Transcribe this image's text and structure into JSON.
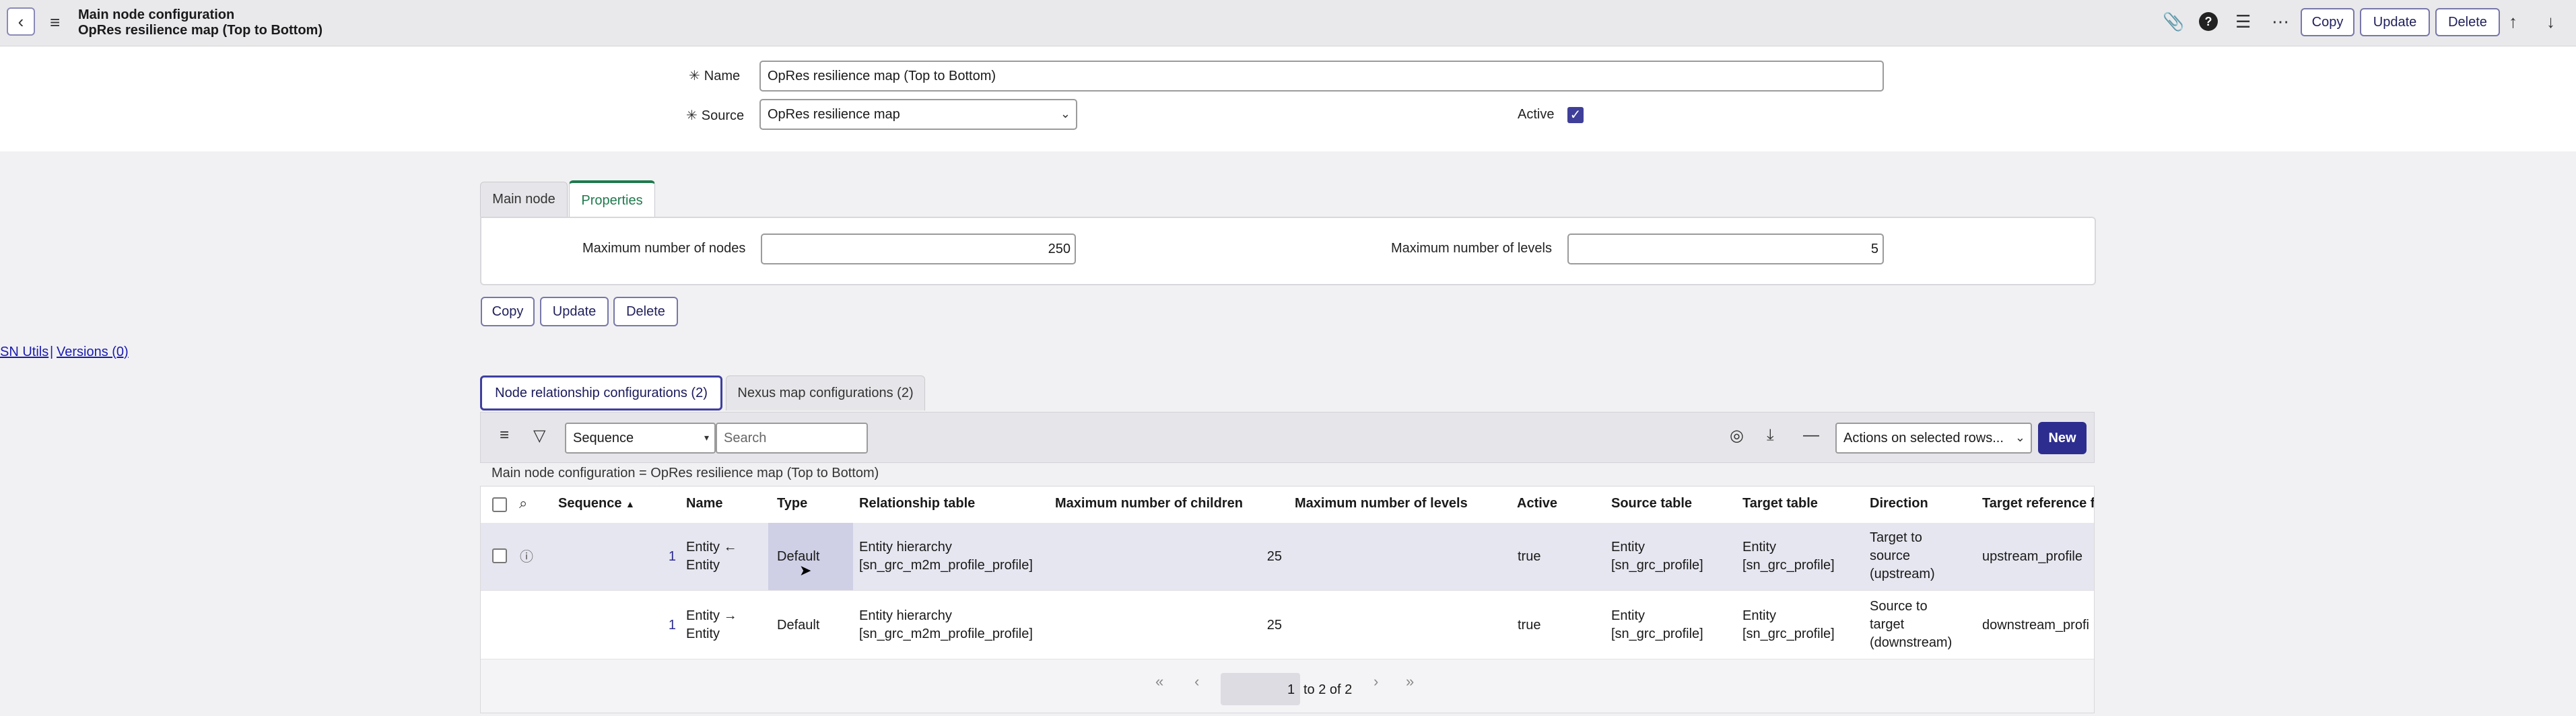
{
  "header": {
    "title": "Main node configuration",
    "subtitle": "OpRes resilience map (Top to Bottom)",
    "buttons": {
      "copy": "Copy",
      "update": "Update",
      "delete": "Delete"
    }
  },
  "form": {
    "name_label": "Name",
    "name_value": "OpRes resilience map (Top to Bottom)",
    "source_label": "Source",
    "source_value": "OpRes resilience map",
    "active_label": "Active",
    "active_checked": true
  },
  "form_tabs": {
    "main_node": "Main node",
    "properties": "Properties"
  },
  "properties": {
    "max_nodes_label": "Maximum number of nodes",
    "max_nodes_value": "250",
    "max_levels_label": "Maximum number of levels",
    "max_levels_value": "5"
  },
  "form_buttons": {
    "copy": "Copy",
    "update": "Update",
    "delete": "Delete"
  },
  "sn_utils": {
    "label": "SN Utils",
    "separator": "|",
    "versions": "Versions (0)"
  },
  "related_tabs": {
    "node_relationship": "Node relationship configurations (2)",
    "nexus_map": "Nexus map configurations (2)"
  },
  "list": {
    "search_field": "Sequence",
    "search_placeholder": "Search",
    "actions_label": "Actions on selected rows...",
    "new_label": "New",
    "breadcrumb": "Main node configuration = OpRes resilience map (Top to Bottom)",
    "columns": [
      "Sequence",
      "Name",
      "Type",
      "Relationship table",
      "Maximum number of children",
      "Maximum number of levels",
      "Active",
      "Source table",
      "Target table",
      "Direction",
      "Target reference f"
    ],
    "sort_indicator": "▲",
    "rows": [
      {
        "sequence": "1",
        "name_1": "Entity ←",
        "name_2": "Entity",
        "type": "Default",
        "rel_1": "Entity hierarchy",
        "rel_2": "[sn_grc_m2m_profile_profile]",
        "max_children": "25",
        "max_levels": "",
        "active": "true",
        "source_1": "Entity",
        "source_2": "[sn_grc_profile]",
        "target_1": "Entity",
        "target_2": "[sn_grc_profile]",
        "dir_1": "Target to",
        "dir_2": "source",
        "dir_3": "(upstream)",
        "target_ref": "upstream_profile"
      },
      {
        "sequence": "1",
        "name_1": "Entity →",
        "name_2": "Entity",
        "type": "Default",
        "rel_1": "Entity hierarchy",
        "rel_2": "[sn_grc_m2m_profile_profile]",
        "max_children": "25",
        "max_levels": "",
        "active": "true",
        "source_1": "Entity",
        "source_2": "[sn_grc_profile]",
        "target_1": "Entity",
        "target_2": "[sn_grc_profile]",
        "dir_1": "Source to",
        "dir_2": "target",
        "dir_3": "(downstream)",
        "target_ref": "downstream_profi"
      }
    ],
    "pagination": {
      "current": "1",
      "range": "to 2 of 2"
    }
  },
  "colors": {
    "accent": "#2d2d8f",
    "active_tab": "#1f7a4d",
    "highlight": "#e6e6f0"
  },
  "icons": [
    "back-icon",
    "menu-icon",
    "paperclip-icon",
    "help-icon",
    "settings-icon",
    "more-icon",
    "arrow-up-icon",
    "arrow-down-icon",
    "filter-icon",
    "search-icon",
    "info-icon",
    "personalize-icon",
    "download-icon",
    "collapse-icon"
  ]
}
